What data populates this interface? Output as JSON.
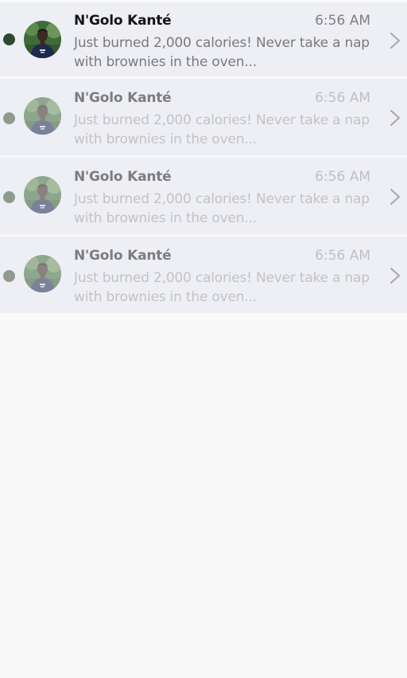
{
  "colors": {
    "unread_dot": "#2c4a2e",
    "read_dot": "#8f9a8e",
    "row_background": "#eeeff5",
    "page_background": "#f9f9f9",
    "chevron": "#a8a8a8"
  },
  "messages": [
    {
      "sender": "N'Golo Kanté",
      "time": "6:56 AM",
      "preview": "Just burned 2,000 calories! Never take a nap with brownies in the oven...",
      "unread": true,
      "icons": {
        "status": "unread-dot-icon",
        "avatar": "avatar",
        "chevron": "chevron-right-icon"
      }
    },
    {
      "sender": "N'Golo Kanté",
      "time": "6:56 AM",
      "preview": "Just burned 2,000 calories! Never take a nap with brownies in the oven...",
      "unread": false,
      "icons": {
        "status": "read-dot-icon",
        "avatar": "avatar",
        "chevron": "chevron-right-icon"
      }
    },
    {
      "sender": "N'Golo Kanté",
      "time": "6:56 AM",
      "preview": "Just burned 2,000 calories! Never take a nap with brownies in the oven...",
      "unread": false,
      "icons": {
        "status": "read-dot-icon",
        "avatar": "avatar",
        "chevron": "chevron-right-icon"
      }
    },
    {
      "sender": "N'Golo Kanté",
      "time": "6:56 AM",
      "preview": "Just burned 2,000 calories! Never take a nap with brownies in the oven...",
      "unread": false,
      "icons": {
        "status": "read-dot-icon",
        "avatar": "avatar",
        "chevron": "chevron-right-icon"
      }
    }
  ]
}
